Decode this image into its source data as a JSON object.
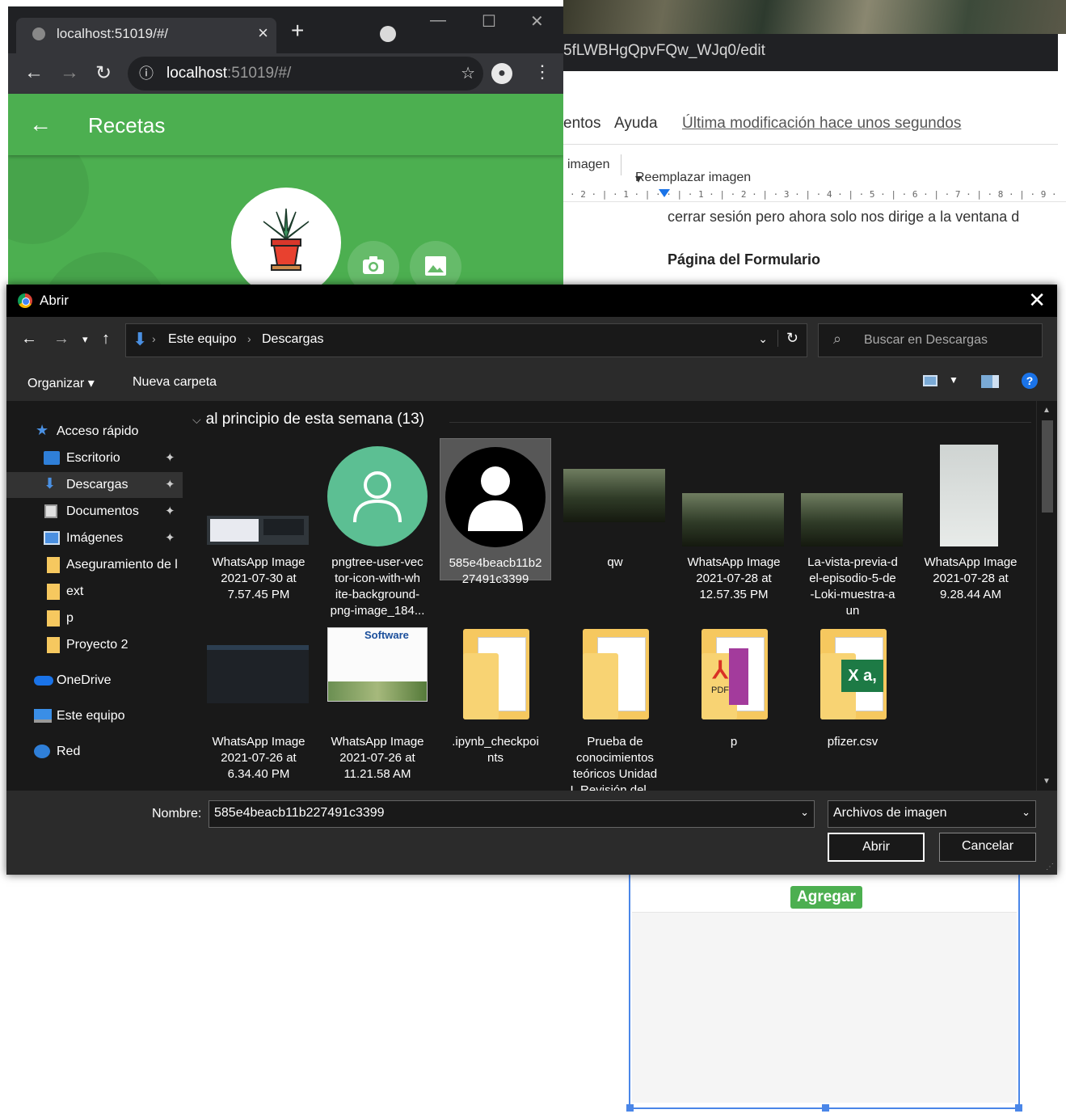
{
  "doc": {
    "url_fragment": "5fLWBHgQpvFQw_WJq0/edit",
    "menu": {
      "partial": "entos",
      "help": "Ayuda",
      "last_modified": "Última modificación hace unos segundos"
    },
    "toolbar": {
      "image_partial": "imagen",
      "replace_image": "Reemplazar imagen"
    },
    "ruler": "· 2 · | · 1 · | ·   · | · 1 · | · 2 · | · 3 · | · 4 · | · 5 · | · 6 · | · 7 · | · 8 · | · 9 ·",
    "body_text": "cerrar sesión pero ahora solo nos dirige a la ventana d",
    "heading": "Página del Formulario",
    "agregar_button": "Agregar"
  },
  "browser": {
    "tab_title": "localhost:51019/#/",
    "url_host": "localhost",
    "url_rest": ":51019/#/",
    "app_title": "Recetas"
  },
  "dialog": {
    "title": "Abrir",
    "breadcrumb": [
      "Este equipo",
      "Descargas"
    ],
    "search_placeholder": "Buscar en Descargas",
    "commands": {
      "organize": "Organizar",
      "new_folder": "Nueva carpeta"
    },
    "sidebar": [
      {
        "label": "Acceso rápido",
        "pinned": false
      },
      {
        "label": "Escritorio",
        "pinned": true
      },
      {
        "label": "Descargas",
        "pinned": true
      },
      {
        "label": "Documentos",
        "pinned": true
      },
      {
        "label": "Imágenes",
        "pinned": true
      },
      {
        "label": "Aseguramiento de l",
        "pinned": false
      },
      {
        "label": "ext",
        "pinned": false
      },
      {
        "label": "p",
        "pinned": false
      },
      {
        "label": "Proyecto 2",
        "pinned": false
      },
      {
        "label": "OneDrive",
        "pinned": false
      },
      {
        "label": "Este equipo",
        "pinned": false
      },
      {
        "label": "Red",
        "pinned": false
      }
    ],
    "group_header": "al principio de esta semana (13)",
    "files": [
      {
        "name": "WhatsApp Image 2021-07-30 at 7.57.45 PM"
      },
      {
        "name": "pngtree-user-vector-icon-with-white-background-png-image_184..."
      },
      {
        "name": "585e4beacb11b227491c3399"
      },
      {
        "name": "qw"
      },
      {
        "name": "WhatsApp Image 2021-07-28 at 12.57.35 PM"
      },
      {
        "name": "La-vista-previa-del-episodio-5-de-Loki-muestra-aun"
      },
      {
        "name": "WhatsApp Image 2021-07-28 at 9.28.44 AM"
      },
      {
        "name": "WhatsApp Image 2021-07-26 at 6.34.40 PM"
      },
      {
        "name": "WhatsApp Image 2021-07-26 at 11.21.58 AM"
      },
      {
        "name": ".ipynb_checkpoints"
      },
      {
        "name": "Prueba de conocimientos teóricos Unidad I_Revisión del ..."
      },
      {
        "name": "p"
      },
      {
        "name": "pfizer.csv"
      }
    ],
    "file_label_lines": [
      [
        "WhatsApp Image",
        "2021-07-30 at",
        "7.57.45 PM"
      ],
      [
        "pngtree-user-vec",
        "tor-icon-with-wh",
        "ite-background-",
        "png-image_184..."
      ],
      [
        "585e4beacb11b2",
        "27491c3399"
      ],
      [
        "qw"
      ],
      [
        "WhatsApp Image",
        "2021-07-28 at",
        "12.57.35 PM"
      ],
      [
        "La-vista-previa-d",
        "el-episodio-5-de",
        "-Loki-muestra-a",
        "un"
      ],
      [
        "WhatsApp Image",
        "2021-07-28 at",
        "9.28.44 AM"
      ],
      [
        "WhatsApp Image",
        "2021-07-26 at",
        "6.34.40 PM"
      ],
      [
        "WhatsApp Image",
        "2021-07-26 at",
        "11.21.58 AM"
      ],
      [
        ".ipynb_checkpoi",
        "nts"
      ],
      [
        "Prueba de",
        "conocimientos",
        "teóricos Unidad",
        "I_Revisión del ..."
      ],
      [
        "p"
      ],
      [
        "pfizer.csv"
      ]
    ],
    "thumb_texts": {
      "slide_logo": "Software",
      "pdf": "PDF",
      "excel": "X a,"
    },
    "selected_file": "585e4beacb11b227491c3399",
    "filename_label": "Nombre:",
    "filename_value": "585e4beacb11b227491c3399",
    "filter_value": "Archivos de imagen",
    "open_button": "Abrir",
    "cancel_button": "Cancelar"
  },
  "colors": {
    "app_green": "#4caf50",
    "dialog_bg": "#191919",
    "accent_blue": "#1a73e8"
  }
}
